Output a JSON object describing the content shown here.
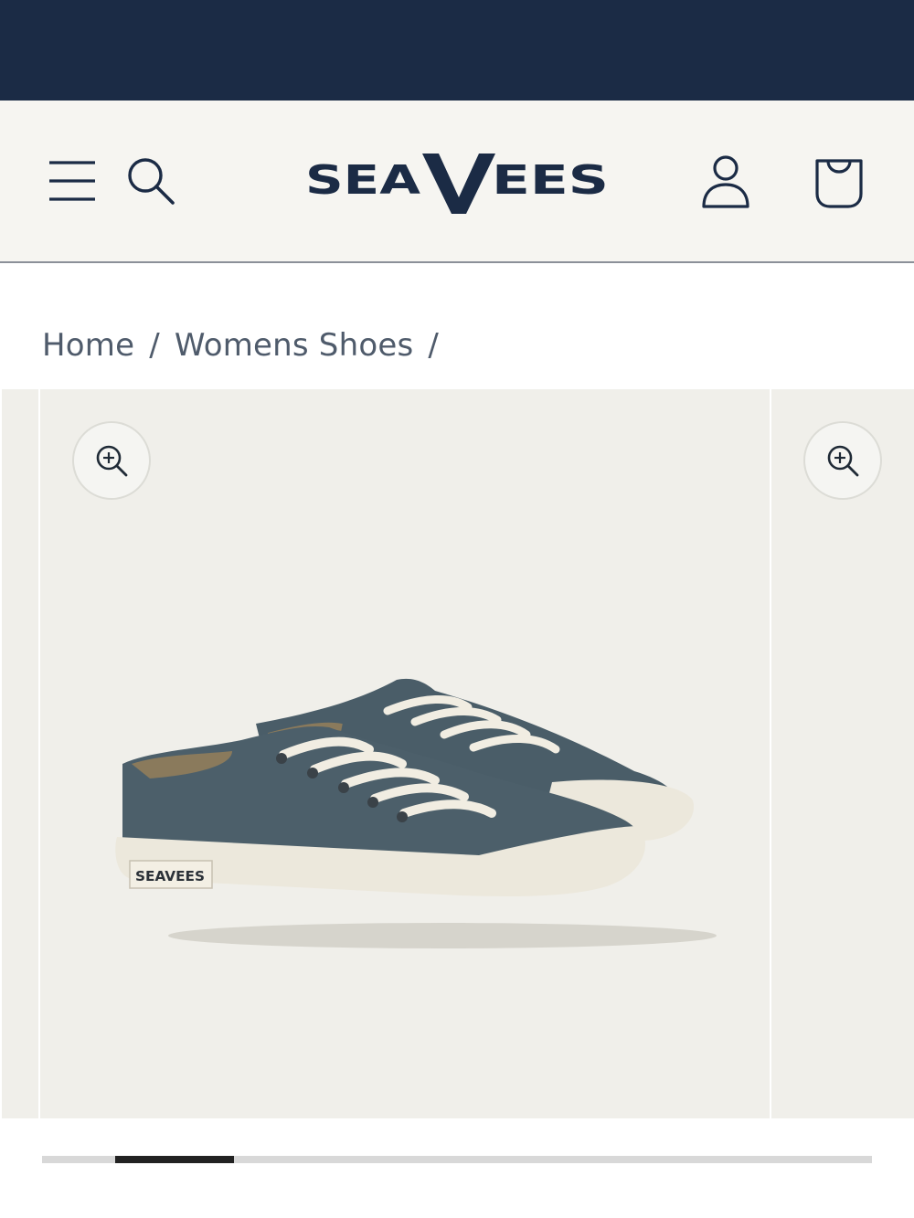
{
  "header": {
    "logo_text": "SEAVEES",
    "icons": {
      "menu": "hamburger-menu-icon",
      "search": "search-icon",
      "account": "user-icon",
      "cart": "shopping-bag-icon"
    }
  },
  "breadcrumb": {
    "items": [
      "Home",
      "Womens Shoes"
    ],
    "separator": "/"
  },
  "gallery": {
    "shoe_label": "SEAVEES",
    "zoom_icon": "zoom-in-icon",
    "active_slide_fraction": 0.14
  },
  "colors": {
    "announcement_bar": "#1b2b45",
    "header_bg": "#f6f5f1",
    "logo": "#1b2b45",
    "slide_bg": "#f0efea",
    "shoe_canvas": "#4c5f6a",
    "sole": "#ede9dd"
  }
}
